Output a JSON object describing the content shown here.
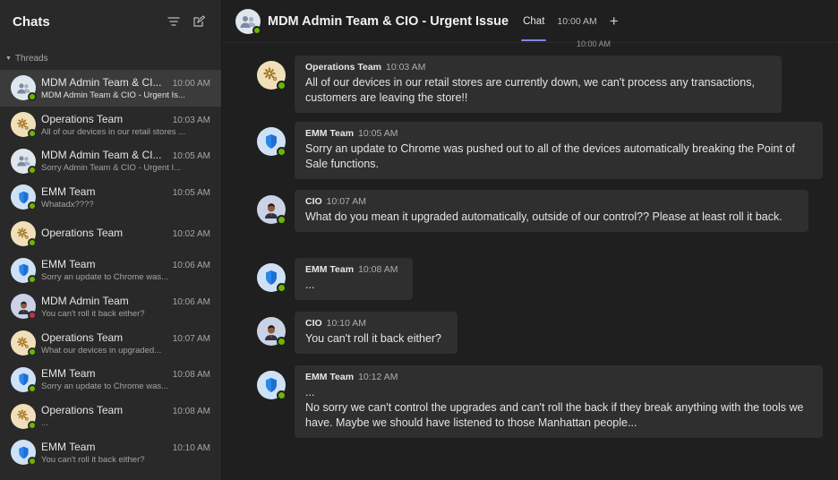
{
  "sidebar": {
    "title": "Chats",
    "filter_icon": "filter-icon",
    "compose_icon": "compose-icon",
    "threads_label": "Threads",
    "threads": [
      {
        "name": "MDM Admin Team & CI...",
        "time": "10:00 AM",
        "preview": "MDM Admin Team & CIO - Urgent Is...",
        "avatar": "group"
      },
      {
        "name": "Operations Team",
        "time": "10:03 AM",
        "preview": "All of our devices in our retail stores ...",
        "avatar": "ops"
      },
      {
        "name": "MDM Admin Team & CI...",
        "time": "10:05 AM",
        "preview": "Sorry Admin Team & CIO - Urgent I...",
        "avatar": "group"
      },
      {
        "name": "EMM Team",
        "time": "10:05 AM",
        "preview": "Whatadx????",
        "avatar": "emm"
      },
      {
        "name": "Operations Team",
        "time": "10:02 AM",
        "preview": "",
        "avatar": "ops"
      },
      {
        "name": "EMM Team",
        "time": "10:06 AM",
        "preview": "Sorry an update to Chrome was...",
        "avatar": "emm"
      },
      {
        "name": "MDM Admin Team",
        "time": "10:06 AM",
        "preview": "You can't roll it back either?",
        "avatar": "person"
      },
      {
        "name": "Operations Team",
        "time": "10:07 AM",
        "preview": "What our devices in upgraded...",
        "avatar": "ops"
      },
      {
        "name": "EMM Team",
        "time": "10:08 AM",
        "preview": "Sorry an update to Chrome was...",
        "avatar": "emm"
      },
      {
        "name": "Operations Team",
        "time": "10:08 AM",
        "preview": "...",
        "avatar": "ops"
      },
      {
        "name": "EMM Team",
        "time": "10:10 AM",
        "preview": "You can't roll it back either?",
        "avatar": "emm"
      }
    ]
  },
  "header": {
    "title": "MDM Admin Team & CIO - Urgent Issue",
    "tab_chat": "Chat",
    "tab_time": "10:00 AM",
    "add_tab": "+",
    "subtime": "10:00 AM"
  },
  "messages": [
    {
      "sender": "Operations Team",
      "time": "10:03 AM",
      "body": "All of our devices in our retail stores are currently down, we can't process any transactions, customers are leaving the store!!",
      "avatar": "ops"
    },
    {
      "sender": "EMM Team",
      "time": "10:05 AM",
      "body": "Sorry an update to Chrome was pushed out to all of the devices automatically breaking the Point of Sale functions.",
      "avatar": "emm"
    },
    {
      "sender": "CIO",
      "time": "10:07 AM",
      "body": "What do you mean it upgraded automatically, outside of our control?? Please at least roll it back.",
      "avatar": "person"
    },
    {
      "sender": "EMM Team",
      "time": "10:08 AM",
      "body": "...",
      "avatar": "emm"
    },
    {
      "sender": "CIO",
      "time": "10:10 AM",
      "body": "You can't roll it back either?",
      "avatar": "person"
    },
    {
      "sender": "EMM Team",
      "time": "10:12 AM",
      "body": "...",
      "body2": "No sorry we can't control the upgrades and can't roll the back if they break anything with the tools we have. Maybe we should have listened to those Manhattan people...",
      "avatar": "emm"
    }
  ],
  "colors": {
    "accent": "#7f85f5",
    "presence_available": "#6bb700",
    "presence_busy": "#c4314b",
    "bubble": "#2f2f2f",
    "sidebar_bg": "#292929"
  }
}
